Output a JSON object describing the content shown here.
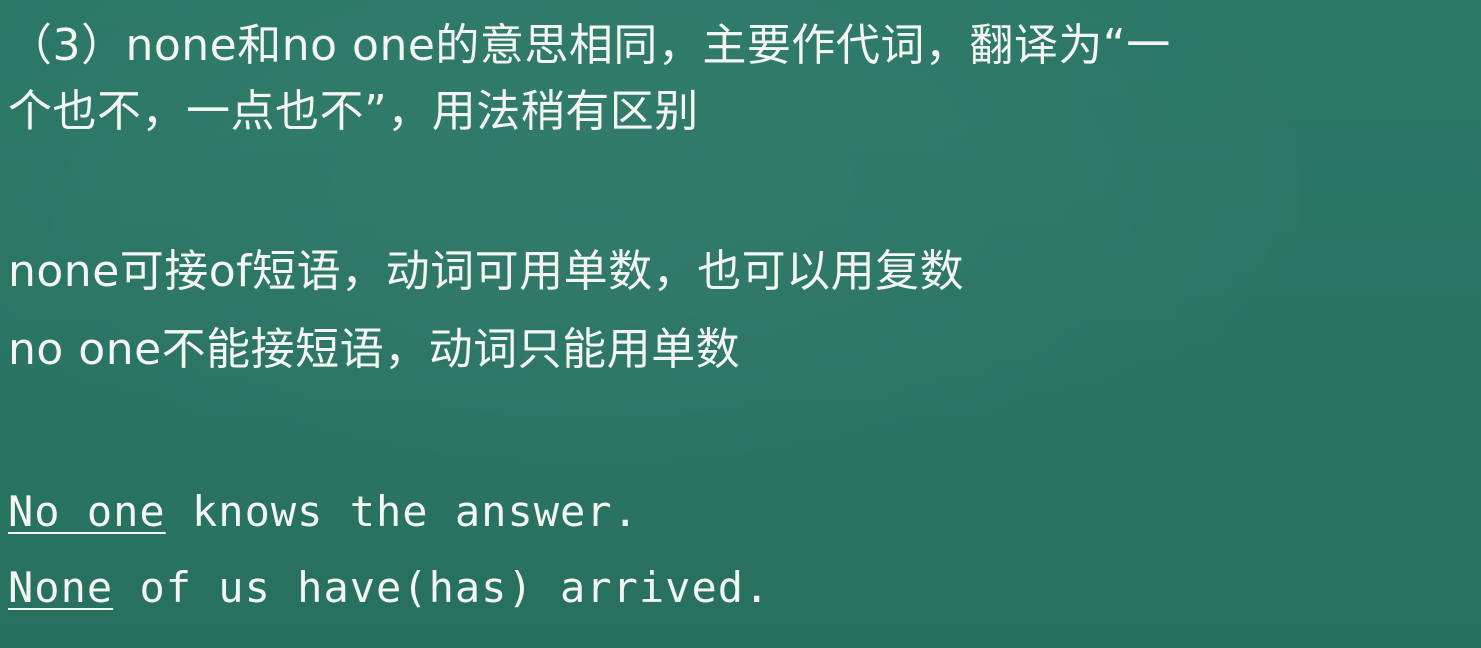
{
  "slide": {
    "heading_line1": "（3）none和no one的意思相同，主要作代词，翻译为“一",
    "heading_line2": "个也不，一点也不”，用法稍有区别",
    "rule_none": "none可接of短语，动词可用单数，也可以用复数",
    "rule_no_one": "no one不能接短语，动词只能用单数",
    "example1": {
      "underlined": "No one",
      "rest": " knows the answer."
    },
    "example2": {
      "underlined": "None",
      "rest": " of us have(has) arrived."
    }
  },
  "colors": {
    "background": "#2a7565",
    "text": "#f3f5f2"
  }
}
